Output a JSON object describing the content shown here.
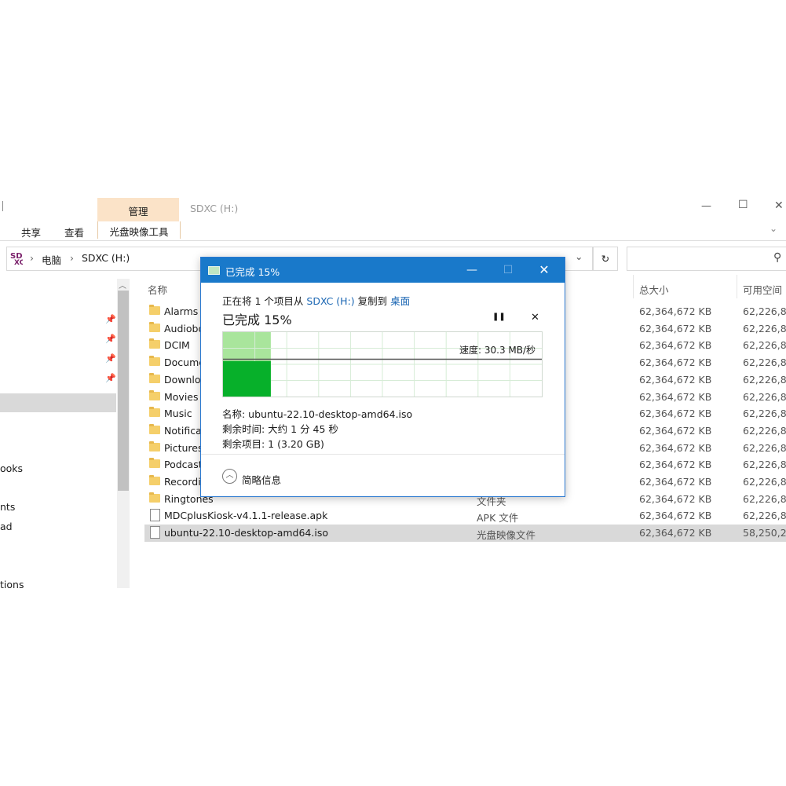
{
  "ribbon": {
    "tab_manage": "管理",
    "tab_share": "共享",
    "tab_view": "查看",
    "tab_image_tools": "光盘映像工具",
    "window_title": "SDXC (H:)"
  },
  "address": {
    "crumb_pc": "电脑",
    "crumb_drive": "SDXC (H:)",
    "refresh_icon": "↻",
    "search_icon": "⚲"
  },
  "nav": {
    "fragments": [
      "ooks",
      "nts",
      "ad",
      "tions"
    ]
  },
  "columns": {
    "name": "名称",
    "total_size": "总大小",
    "free_space": "可用空间"
  },
  "files": [
    {
      "name": "Alarms",
      "type": "",
      "size": "62,364,672 KB",
      "free": "62,226,8",
      "kind": "folder"
    },
    {
      "name": "Audiobo",
      "type": "",
      "size": "62,364,672 KB",
      "free": "62,226,8",
      "kind": "folder"
    },
    {
      "name": "DCIM",
      "type": "",
      "size": "62,364,672 KB",
      "free": "62,226,8",
      "kind": "folder"
    },
    {
      "name": "Docume",
      "type": "",
      "size": "62,364,672 KB",
      "free": "62,226,8",
      "kind": "folder"
    },
    {
      "name": "Downlo",
      "type": "",
      "size": "62,364,672 KB",
      "free": "62,226,8",
      "kind": "folder"
    },
    {
      "name": "Movies",
      "type": "",
      "size": "62,364,672 KB",
      "free": "62,226,8",
      "kind": "folder"
    },
    {
      "name": "Music",
      "type": "",
      "size": "62,364,672 KB",
      "free": "62,226,8",
      "kind": "folder"
    },
    {
      "name": "Notifica",
      "type": "",
      "size": "62,364,672 KB",
      "free": "62,226,8",
      "kind": "folder"
    },
    {
      "name": "Pictures",
      "type": "",
      "size": "62,364,672 KB",
      "free": "62,226,8",
      "kind": "folder"
    },
    {
      "name": "Podcast",
      "type": "",
      "size": "62,364,672 KB",
      "free": "62,226,8",
      "kind": "folder"
    },
    {
      "name": "Recordi",
      "type": "",
      "size": "62,364,672 KB",
      "free": "62,226,8",
      "kind": "folder"
    },
    {
      "name": "Ringtones",
      "type": "文件夹",
      "size": "62,364,672 KB",
      "free": "62,226,8",
      "kind": "folder"
    },
    {
      "name": "MDCplusKiosk-v4.1.1-release.apk",
      "type": "APK 文件",
      "size": "62,364,672 KB",
      "free": "62,226,8",
      "kind": "file"
    },
    {
      "name": "ubuntu-22.10-desktop-amd64.iso",
      "type": "光盘映像文件",
      "size": "62,364,672 KB",
      "free": "58,250,2",
      "kind": "file"
    }
  ],
  "dialog": {
    "title": "已完成 15%",
    "copy_prefix": "正在将 1 个项目从",
    "source": "SDXC (H:)",
    "copy_mid": "复制到",
    "destination": "桌面",
    "progress_text": "已完成 15%",
    "progress": 0.15,
    "speed": "速度: 30.3 MB/秒",
    "name_line": "名称: ubuntu-22.10-desktop-amd64.iso",
    "time_line": "剩余时间: 大约 1 分 45 秒",
    "items_line": "剩余项目: 1 (3.20 GB)",
    "details_toggle": "简略信息",
    "minimize_icon": "—",
    "maximize_icon": "☐",
    "close_icon": "✕",
    "pause_icon": "❚❚",
    "cancel_icon": "✕"
  },
  "window_controls": {
    "minimize": "—",
    "maximize": "☐",
    "close": "✕"
  },
  "colors": {
    "accent": "#1979ca",
    "progress_green": "#07b02a",
    "progress_light": "#a9e59c"
  }
}
